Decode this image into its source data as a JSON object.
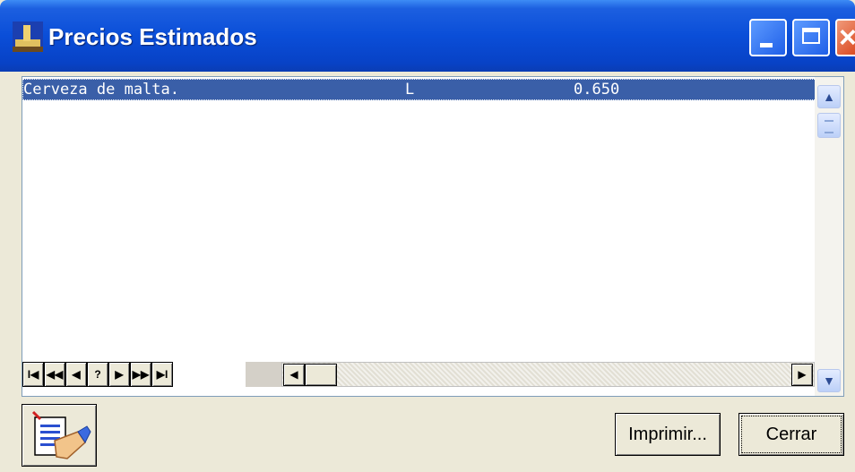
{
  "window": {
    "title": "Precios Estimados"
  },
  "grid": {
    "selected_row": {
      "name": "Cerveza de malta.",
      "unit": "L",
      "price": "0.650"
    }
  },
  "navigator": {
    "first": "I◀",
    "prior_page": "◀◀",
    "prior": "◀",
    "help": "?",
    "next": "▶",
    "next_page": "▶▶",
    "last": "▶I"
  },
  "buttons": {
    "print_label": "Imprimir...",
    "close_label": "Cerrar"
  },
  "colors": {
    "titlebar": "#0a4ed8",
    "selection": "#3a5fa8"
  }
}
